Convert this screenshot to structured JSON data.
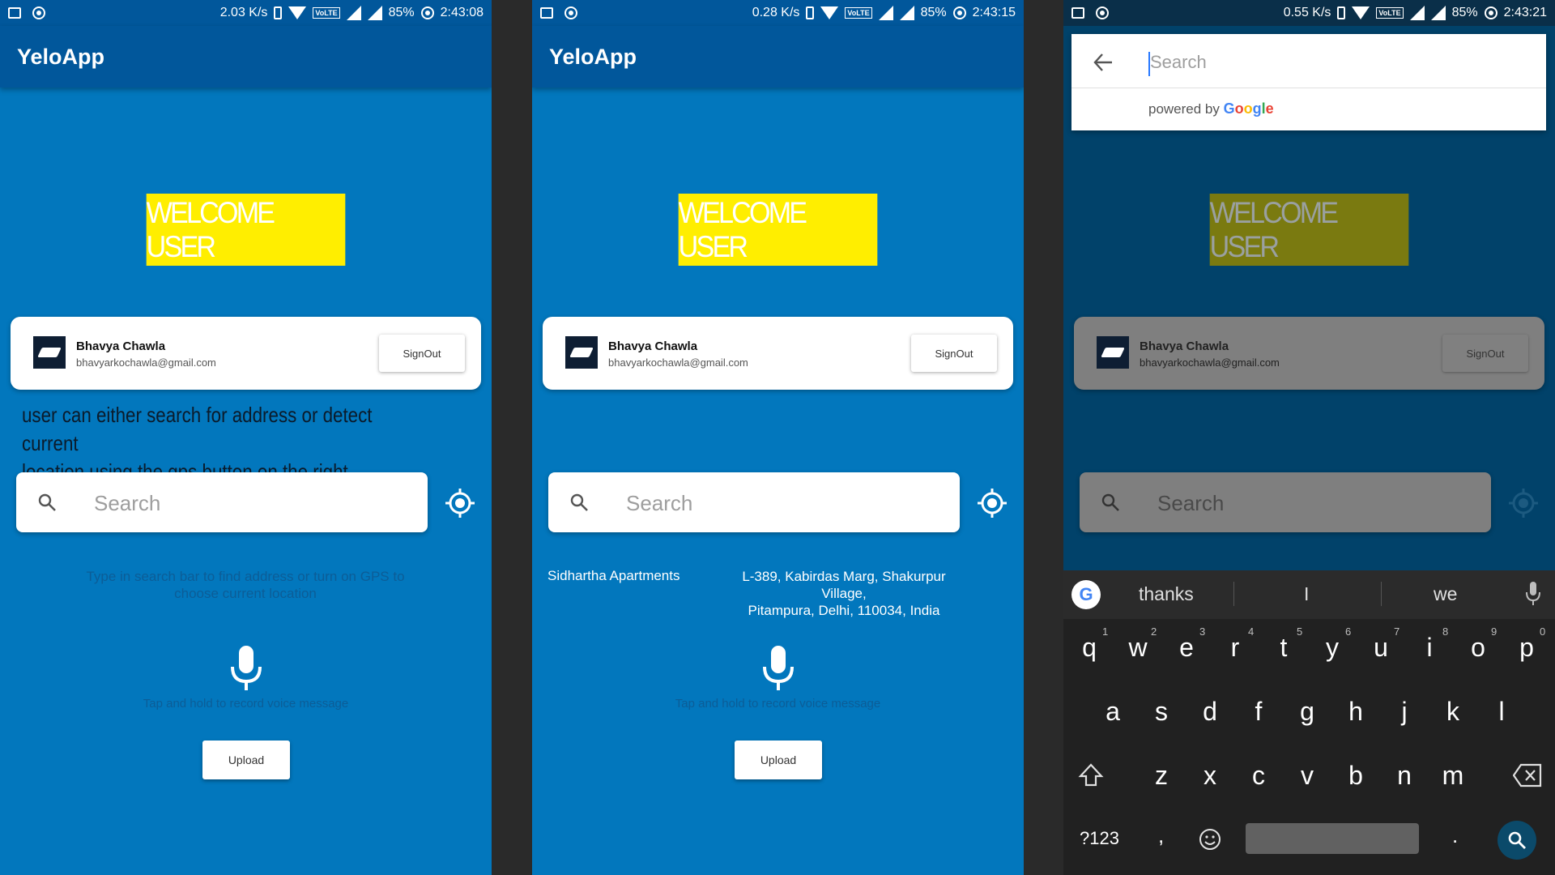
{
  "app_title": "YeloApp",
  "colors": {
    "app_blue": "#0277bd",
    "app_bar": "#01579b",
    "welcome_yellow": "#ffee00",
    "overlay_dark": "#01426a",
    "keyboard_bg": "#212121"
  },
  "screens": [
    {
      "status": {
        "speed": "2.03 K/s",
        "volte": "VoLTE",
        "battery": "85%",
        "time": "2:43:08"
      },
      "welcome": "WELCOME USER",
      "user": {
        "name": "Bhavya Chawla",
        "email": "bhavyarkochawla@gmail.com",
        "signout": "SignOut"
      },
      "caption_line1": "user can either search for address or detect current",
      "caption_line2": "location using the gps button on the right",
      "search": {
        "placeholder": "Search"
      },
      "hint_line1": "Type in search bar to find address or turn on GPS to",
      "hint_line2": "choose current location",
      "voice_hint": "Tap and hold to record voice message",
      "upload": "Upload"
    },
    {
      "status": {
        "speed": "0.28 K/s",
        "volte": "VoLTE",
        "battery": "85%",
        "time": "2:43:15"
      },
      "welcome": "WELCOME USER",
      "user": {
        "name": "Bhavya Chawla",
        "email": "bhavyarkochawla@gmail.com",
        "signout": "SignOut"
      },
      "search": {
        "placeholder": "Search"
      },
      "result_name": "Sidhartha Apartments",
      "result_address_line1": "L-389, Kabirdas Marg, Shakurpur Village,",
      "result_address_line2": "Pitampura, Delhi, 110034, India",
      "voice_hint": "Tap and hold to record voice message",
      "upload": "Upload"
    },
    {
      "status": {
        "speed": "0.55 K/s",
        "volte": "VoLTE",
        "battery": "85%",
        "time": "2:43:21"
      },
      "welcome": "WELCOME USER",
      "user": {
        "name": "Bhavya Chawla",
        "email": "bhavyarkochawla@gmail.com",
        "signout": "SignOut"
      },
      "search": {
        "placeholder": "Search"
      },
      "places": {
        "placeholder": "Search",
        "powered_by": "powered by",
        "google_letters": [
          "G",
          "o",
          "o",
          "g",
          "l",
          "e"
        ]
      },
      "keyboard": {
        "suggestions": [
          "thanks",
          "I",
          "we"
        ],
        "row1": [
          "q",
          "w",
          "e",
          "r",
          "t",
          "y",
          "u",
          "i",
          "o",
          "p"
        ],
        "row1_numbers": [
          "1",
          "2",
          "3",
          "4",
          "5",
          "6",
          "7",
          "8",
          "9",
          "0"
        ],
        "row2": [
          "a",
          "s",
          "d",
          "f",
          "g",
          "h",
          "j",
          "k",
          "l"
        ],
        "row3": [
          "z",
          "x",
          "c",
          "v",
          "b",
          "n",
          "m"
        ],
        "symbols": "?123",
        "comma": ",",
        "period": "."
      }
    }
  ]
}
